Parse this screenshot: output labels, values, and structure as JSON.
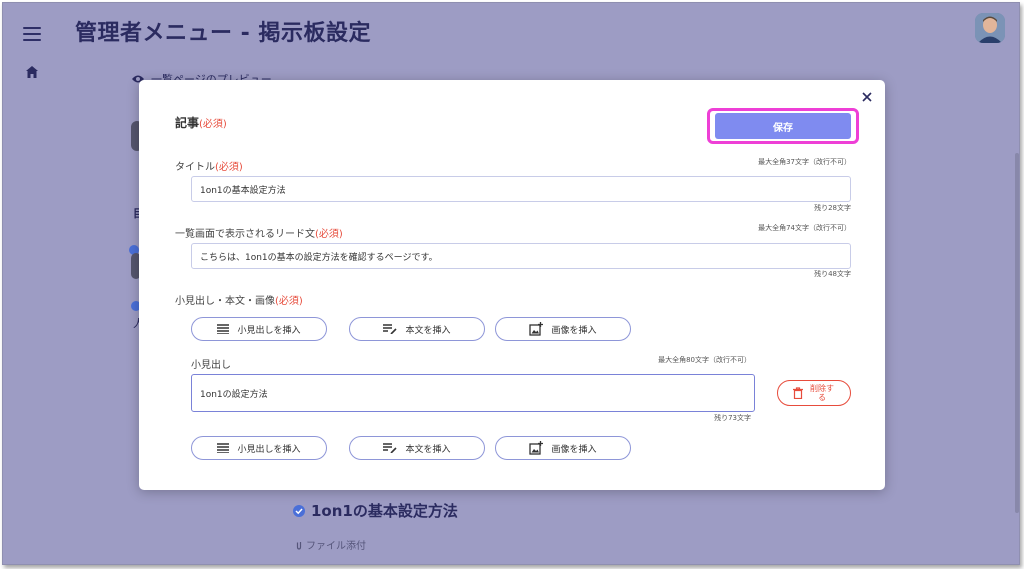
{
  "header": {
    "title": "管理者メニュー - 掲示板設定"
  },
  "background": {
    "preview_label": "一覧ページのプレビュー",
    "article_title": "1on1の基本設定方法",
    "attachment_label": "ファイル添付"
  },
  "modal": {
    "section_title": "記事",
    "required_mark": "(必須)",
    "save_label": "保存",
    "title_field": {
      "label": "タイトル",
      "hint": "最大全角37文字（改行不可）",
      "value": "1on1の基本設定方法",
      "remaining": "残り28文字"
    },
    "lead_field": {
      "label": "一覧画面で表示されるリード文",
      "hint": "最大全角74文字（改行不可）",
      "value": "こちらは、1on1の基本の設定方法を確認するページです。",
      "remaining": "残り48文字"
    },
    "body_section": {
      "label": "小見出し・本文・画像"
    },
    "insert_buttons": {
      "heading": "小見出しを挿入",
      "text": "本文を挿入",
      "image": "画像を挿入"
    },
    "subheading_field": {
      "label": "小見出し",
      "hint": "最大全角80文字（改行不可）",
      "value": "1on1の設定方法",
      "remaining": "残り73文字"
    },
    "delete_label": "削除する"
  },
  "colors": {
    "overlay": "#9d9cc4",
    "accent": "#7f8bf0",
    "required": "#e74c3c",
    "highlight": "#ee3fd6"
  }
}
